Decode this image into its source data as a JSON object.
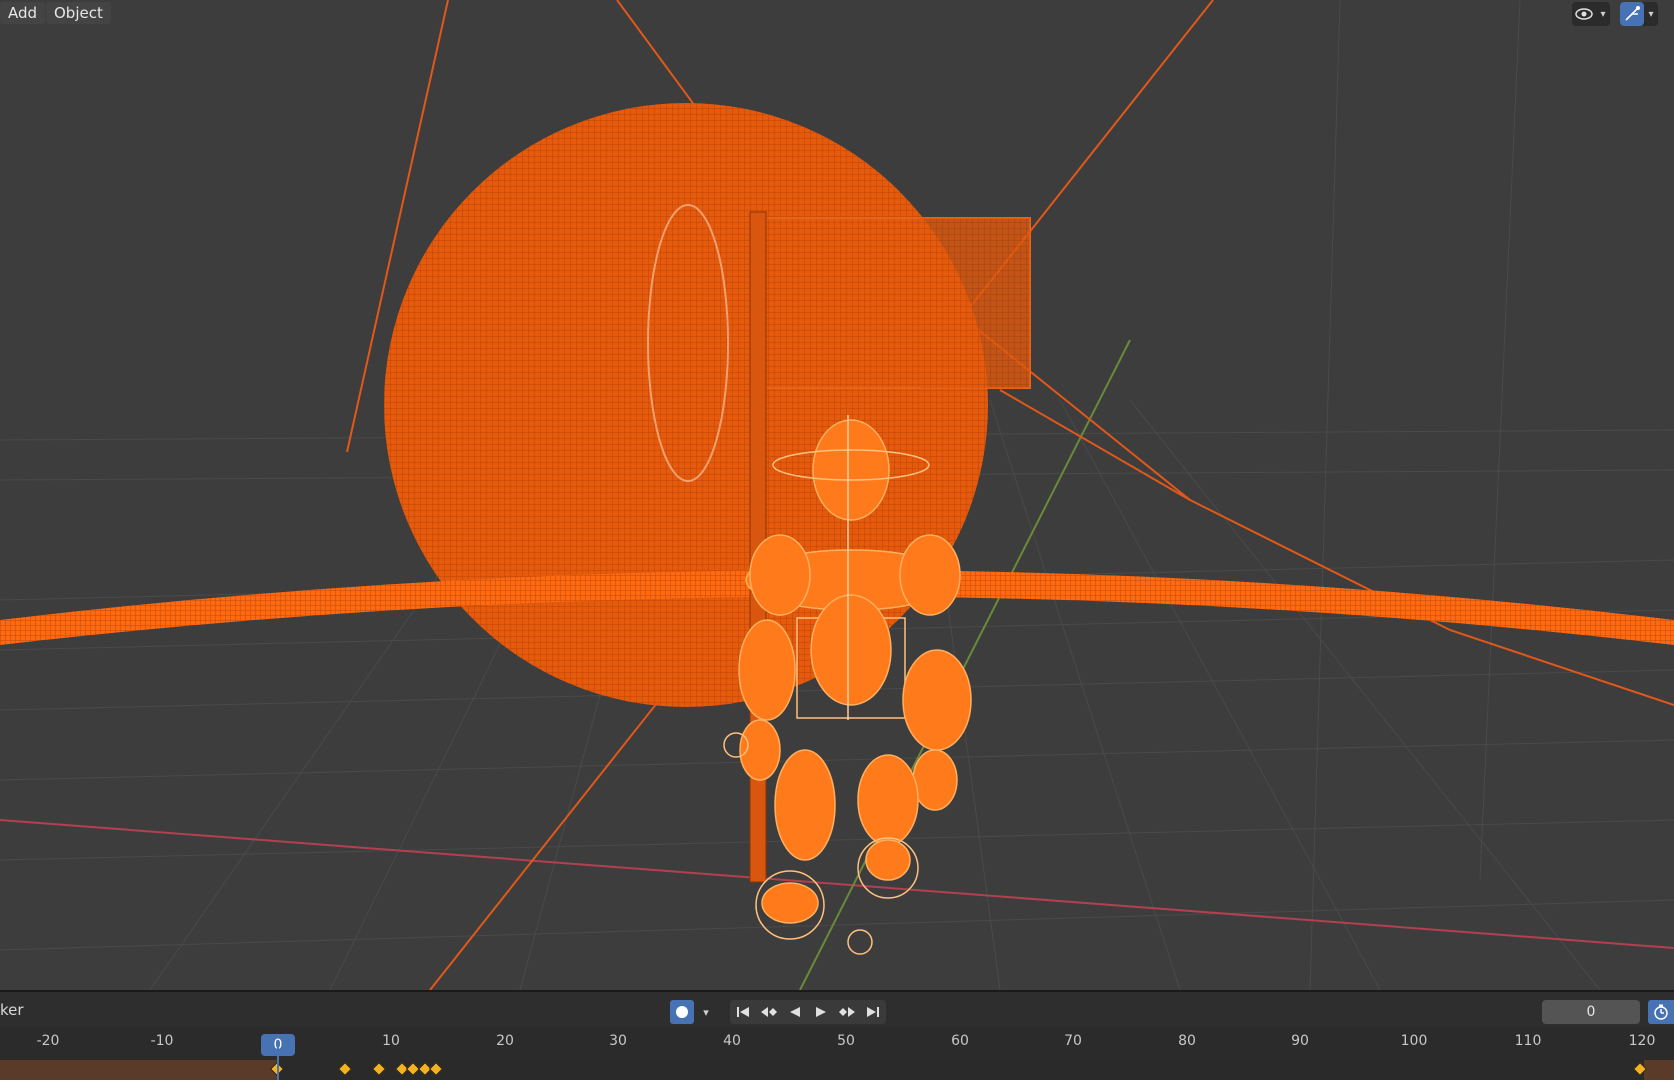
{
  "header": {
    "menus": [
      {
        "label": "Add"
      },
      {
        "label": "Object"
      }
    ],
    "right_icons": [
      "eye-icon",
      "gizmo-icon"
    ]
  },
  "timeline": {
    "label": "ker",
    "current_frame": "0",
    "ruler_ticks": [
      "-20",
      "-10",
      "10",
      "20",
      "30",
      "40",
      "50",
      "60",
      "70",
      "80",
      "90",
      "100",
      "110",
      "120"
    ],
    "playhead_label": "0",
    "keyframe_frames": [
      0,
      6,
      9,
      11,
      12,
      13,
      14,
      120
    ]
  },
  "colors": {
    "accent": "#4772b3",
    "selection": "#ff6a00",
    "keyframe": "#f4b220",
    "background": "#3d3d3d"
  }
}
